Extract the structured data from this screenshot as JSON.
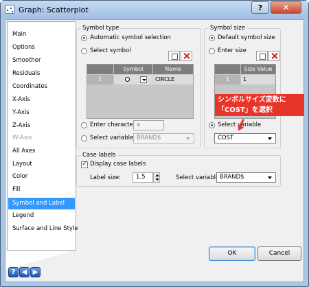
{
  "window": {
    "title": "Graph: Scatterplot",
    "help_glyph": "?",
    "close_glyph": "✕"
  },
  "nav": {
    "items": [
      {
        "label": "Main"
      },
      {
        "label": "Options"
      },
      {
        "label": "Smoother"
      },
      {
        "label": "Residuals"
      },
      {
        "label": "Coordinates"
      },
      {
        "label": "X-Axis"
      },
      {
        "label": "Y-Axis"
      },
      {
        "label": "Z-Axis"
      },
      {
        "label": "W-Axis"
      },
      {
        "label": "All Axes"
      },
      {
        "label": "Layout"
      },
      {
        "label": "Color"
      },
      {
        "label": "Fill"
      },
      {
        "label": "Symbol and Label"
      },
      {
        "label": "Legend"
      },
      {
        "label": "Surface and Line Style"
      }
    ],
    "selected": "Symbol and Label",
    "disabled": [
      "W-Axis"
    ]
  },
  "symbol_type": {
    "legend": "Symbol type",
    "auto_label": "Automatic symbol selection",
    "select_label": "Select symbol",
    "grid_headers": [
      "Symbol",
      "Name"
    ],
    "grid_row": {
      "index": "1",
      "name": "CIRCLE"
    },
    "enter_char_label": "Enter character",
    "enter_char_value": "a",
    "select_var_label": "Select variable",
    "select_var_value": "BRAND$"
  },
  "symbol_size": {
    "legend": "Symbol size",
    "default_label": "Default symbol size",
    "enter_label": "Enter size",
    "grid_header": "Size Value",
    "grid_row": {
      "index": "1",
      "value": "1"
    },
    "select_var_label": "Select variable",
    "select_var_value": "COST"
  },
  "case_labels": {
    "legend": "Case labels",
    "display_label": "Display case labels",
    "display_checked": true,
    "label_size_label": "Label size:",
    "label_size_value": "1.5",
    "select_var_label": "Select variable:",
    "select_var_value": "BRAND$"
  },
  "annotation": {
    "line1": "シンボルサイズ変数に",
    "line2": "「COST」を選択"
  },
  "footer": {
    "ok": "OK",
    "cancel": "Cancel",
    "help_glyph": "?",
    "back_glyph": "◀",
    "forward_glyph": "▶"
  },
  "colors": {
    "selection": "#3399ff",
    "annotation": "#e8352b",
    "title_bar": "#a9c6e6"
  }
}
